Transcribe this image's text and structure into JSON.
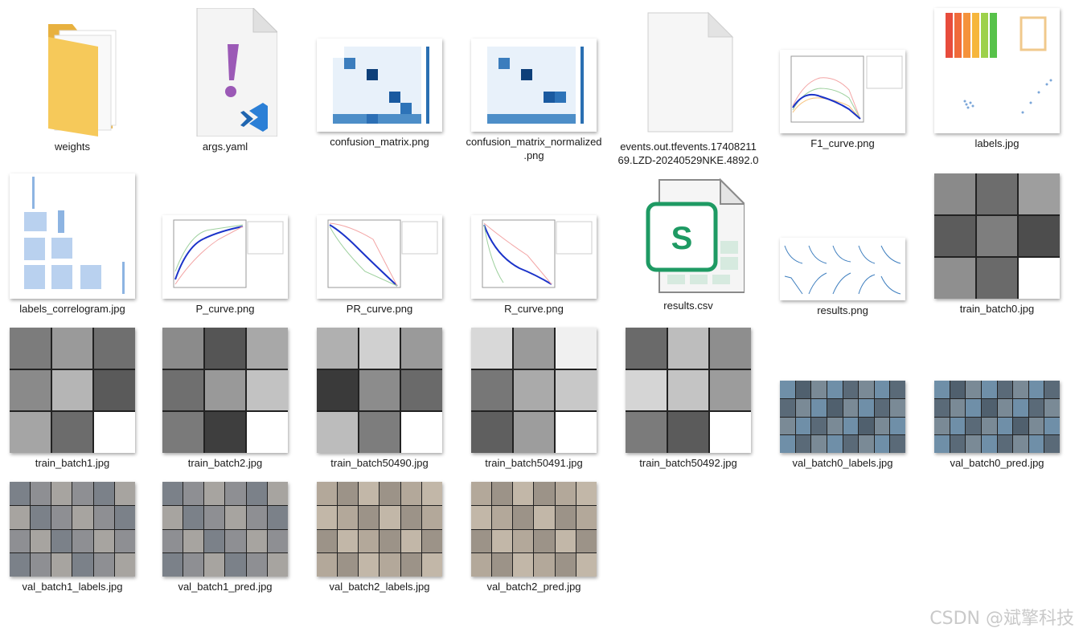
{
  "files": [
    {
      "name": "weights",
      "type": "folder"
    },
    {
      "name": "args.yaml",
      "type": "yaml"
    },
    {
      "name": "confusion_matrix.png",
      "type": "image"
    },
    {
      "name": "confusion_matrix_normalized.png",
      "type": "image"
    },
    {
      "name": "events.out.tfevents.1740821169.LZD-20240529NKE.4892.0",
      "type": "file"
    },
    {
      "name": "F1_curve.png",
      "type": "image"
    },
    {
      "name": "labels.jpg",
      "type": "image"
    },
    {
      "name": "labels_correlogram.jpg",
      "type": "image"
    },
    {
      "name": "P_curve.png",
      "type": "image"
    },
    {
      "name": "PR_curve.png",
      "type": "image"
    },
    {
      "name": "R_curve.png",
      "type": "image"
    },
    {
      "name": "results.csv",
      "type": "spreadsheet"
    },
    {
      "name": "results.png",
      "type": "image"
    },
    {
      "name": "train_batch0.jpg",
      "type": "image"
    },
    {
      "name": "train_batch1.jpg",
      "type": "image"
    },
    {
      "name": "train_batch2.jpg",
      "type": "image"
    },
    {
      "name": "train_batch50490.jpg",
      "type": "image"
    },
    {
      "name": "train_batch50491.jpg",
      "type": "image"
    },
    {
      "name": "train_batch50492.jpg",
      "type": "image"
    },
    {
      "name": "val_batch0_labels.jpg",
      "type": "image"
    },
    {
      "name": "val_batch0_pred.jpg",
      "type": "image"
    },
    {
      "name": "val_batch1_labels.jpg",
      "type": "image"
    },
    {
      "name": "val_batch1_pred.jpg",
      "type": "image"
    },
    {
      "name": "val_batch2_labels.jpg",
      "type": "image"
    },
    {
      "name": "val_batch2_pred.jpg",
      "type": "image"
    }
  ],
  "labels_display": {
    "events_line1": "events.out.tfevents.17408211",
    "events_line2": "69.LZD-20240529NKE.4892.0",
    "cm_norm_line1": "confusion_matrix_normalized",
    "cm_norm_line2": ".png"
  },
  "watermark": "CSDN @斌擎科技",
  "colors": {
    "folder": "#f5c451",
    "yaml_mark": "#9b59b6",
    "vscode": "#2b7fd6",
    "sheet": "#1e9a63"
  }
}
